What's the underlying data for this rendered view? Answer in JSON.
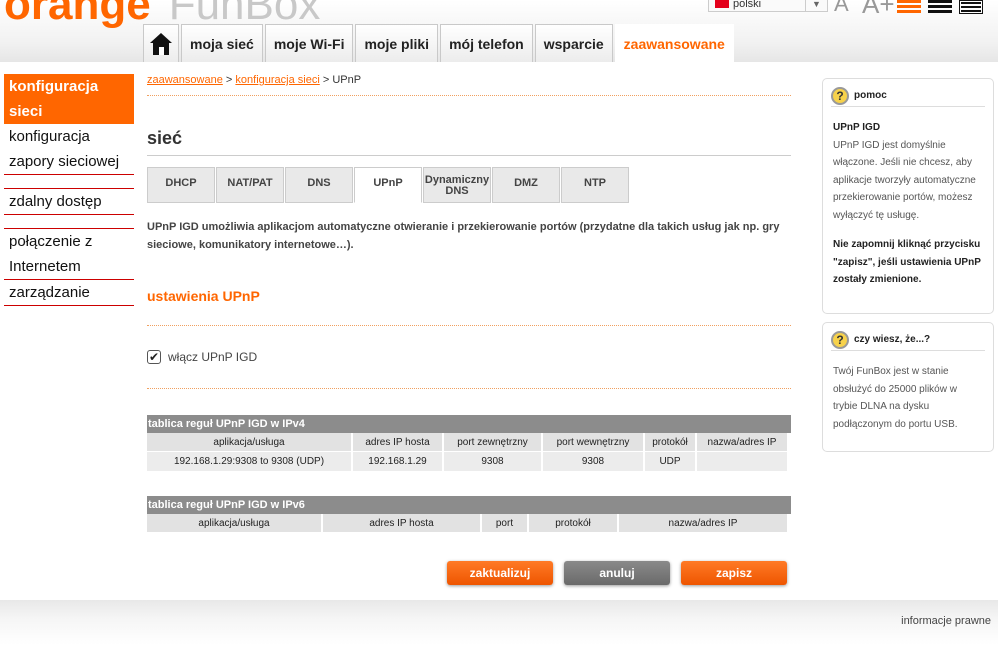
{
  "header": {
    "logo_orange": "orange",
    "logo_funbox": "FunBox",
    "language": "polski",
    "text_small": "A",
    "text_large": "A+"
  },
  "nav": {
    "tabs": [
      "moja sieć",
      "moje Wi-Fi",
      "moje pliki",
      "mój telefon",
      "wsparcie",
      "zaawansowane"
    ]
  },
  "sidebar": {
    "items": [
      "konfiguracja sieci",
      "konfiguracja zapory sieciowej",
      "zdalny dostęp",
      "połączenie z Internetem",
      "zarządzanie"
    ]
  },
  "breadcrumb": {
    "link1": "zaawansowane",
    "sep": ">",
    "link2": "konfiguracja sieci",
    "current": "UPnP"
  },
  "main": {
    "title": "sieć",
    "subtabs": [
      "DHCP",
      "NAT/PAT",
      "DNS",
      "UPnP",
      "Dynamiczny DNS",
      "DMZ",
      "NTP"
    ],
    "description": "UPnP IGD umożliwia aplikacjom automatyczne otwieranie i przekierowanie portów (przydatne dla takich usług jak np. gry sieciowe, komunikatory internetowe…).",
    "section_title": "ustawienia UPnP",
    "checkbox_label": "włącz UPnP IGD",
    "checkbox_checked": true
  },
  "table_ipv4": {
    "title": "tablica reguł UPnP IGD w IPv4",
    "columns": [
      "aplikacja/usługa",
      "adres IP hosta",
      "port zewnętrzny",
      "port wewnętrzny",
      "protokół",
      "nazwa/adres IP"
    ],
    "rows": [
      [
        "192.168.1.29:9308 to 9308 (UDP)",
        "192.168.1.29",
        "9308",
        "9308",
        "UDP",
        ""
      ]
    ]
  },
  "table_ipv6": {
    "title": "tablica reguł UPnP IGD w IPv6",
    "columns": [
      "aplikacja/usługa",
      "adres IP hosta",
      "port",
      "protokół",
      "nazwa/adres IP"
    ]
  },
  "buttons": {
    "refresh": "zaktualizuj",
    "cancel": "anuluj",
    "save": "zapisz"
  },
  "help": {
    "title": "pomoc",
    "heading": "UPnP IGD",
    "text": "UPnP IGD jest domyślnie włączone. Jeśli nie chcesz, aby aplikacje tworzyły automatyczne przekierowanie portów, możesz wyłączyć tę usługę.",
    "note": "Nie zapomnij kliknąć przycisku \"zapisz\", jeśli ustawienia UPnP zostały zmienione."
  },
  "didyouknow": {
    "title": "czy wiesz, że...?",
    "text": "Twój FunBox jest w stanie obsłużyć do 25000 plików w trybie DLNA na dysku podłączonym do portu USB."
  },
  "footer": {
    "legal": "informacje prawne"
  },
  "colors": {
    "accent": "#ff6600",
    "table_header": "#8c8c8c"
  }
}
